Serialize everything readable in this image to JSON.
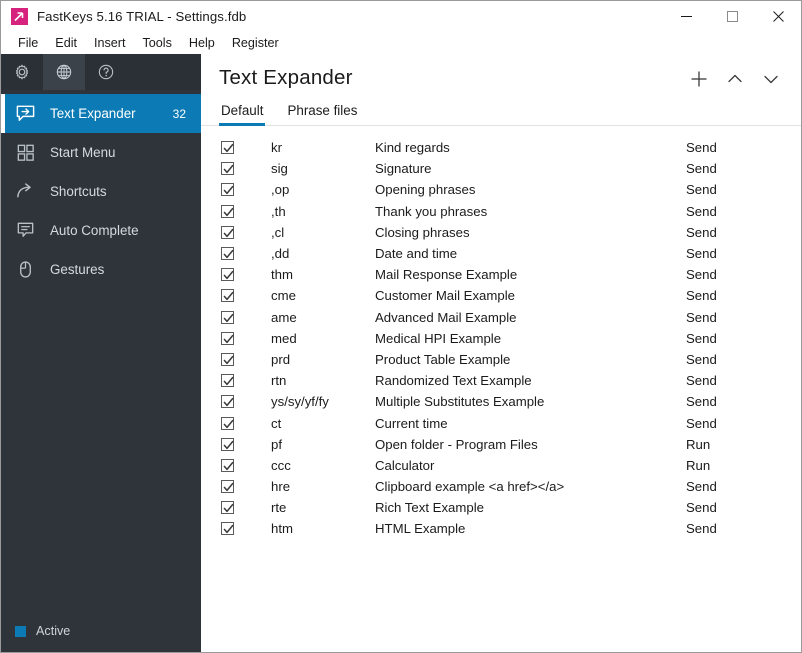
{
  "window": {
    "title": "FastKeys 5.16 TRIAL - Settings.fdb",
    "app_icon": "fastkeys-logo-icon",
    "controls": [
      {
        "name": "minimize-button",
        "icon": "minimize-icon"
      },
      {
        "name": "maximize-button",
        "icon": "maximize-icon"
      },
      {
        "name": "close-button",
        "icon": "close-icon"
      }
    ]
  },
  "menubar": {
    "items": [
      {
        "label": "File"
      },
      {
        "label": "Edit"
      },
      {
        "label": "Insert"
      },
      {
        "label": "Tools"
      },
      {
        "label": "Help"
      },
      {
        "label": "Register"
      }
    ]
  },
  "sidebar": {
    "icon_strip": [
      {
        "name": "settings-gear-icon",
        "icon": "gear-icon",
        "active": false
      },
      {
        "name": "globe-language-icon",
        "icon": "globe-icon",
        "active": true
      },
      {
        "name": "help-icon",
        "icon": "question-circle-icon",
        "active": false
      }
    ],
    "items": [
      {
        "label": "Text Expander",
        "icon": "text-expander-icon",
        "badge": "32",
        "selected": true
      },
      {
        "label": "Start Menu",
        "icon": "grid-squares-icon",
        "badge": "",
        "selected": false
      },
      {
        "label": "Shortcuts",
        "icon": "curved-arrow-icon",
        "badge": "",
        "selected": false
      },
      {
        "label": "Auto Complete",
        "icon": "speech-bubble-lines-icon",
        "badge": "",
        "selected": false
      },
      {
        "label": "Gestures",
        "icon": "mouse-icon",
        "badge": "",
        "selected": false
      }
    ],
    "status": {
      "label": "Active",
      "dot_color": "#0b7ab5"
    }
  },
  "main": {
    "title": "Text Expander",
    "actions": [
      {
        "name": "add-button",
        "icon": "plus-icon"
      },
      {
        "name": "move-up-button",
        "icon": "chevron-up-icon"
      },
      {
        "name": "move-down-button",
        "icon": "chevron-down-icon"
      }
    ],
    "tabs": [
      {
        "label": "Default",
        "active": true
      },
      {
        "label": "Phrase files",
        "active": false
      }
    ],
    "rows": [
      {
        "checked": true,
        "abbr": "kr",
        "desc": "Kind regards",
        "action": "Send"
      },
      {
        "checked": true,
        "abbr": "sig",
        "desc": "Signature",
        "action": "Send"
      },
      {
        "checked": true,
        "abbr": ",op",
        "desc": "Opening phrases",
        "action": "Send"
      },
      {
        "checked": true,
        "abbr": ",th",
        "desc": "Thank you phrases",
        "action": "Send"
      },
      {
        "checked": true,
        "abbr": ",cl",
        "desc": "Closing phrases",
        "action": "Send"
      },
      {
        "checked": true,
        "abbr": ",dd",
        "desc": "Date and time",
        "action": "Send"
      },
      {
        "checked": true,
        "abbr": "thm",
        "desc": "Mail Response Example",
        "action": "Send"
      },
      {
        "checked": true,
        "abbr": "cme",
        "desc": "Customer Mail Example",
        "action": "Send"
      },
      {
        "checked": true,
        "abbr": "ame",
        "desc": "Advanced Mail Example",
        "action": "Send"
      },
      {
        "checked": true,
        "abbr": "med",
        "desc": "Medical HPI Example",
        "action": "Send"
      },
      {
        "checked": true,
        "abbr": "prd",
        "desc": "Product Table Example",
        "action": "Send"
      },
      {
        "checked": true,
        "abbr": "rtn",
        "desc": "Randomized Text Example",
        "action": "Send"
      },
      {
        "checked": true,
        "abbr": "ys/sy/yf/fy",
        "desc": "Multiple Substitutes Example",
        "action": "Send"
      },
      {
        "checked": true,
        "abbr": "ct",
        "desc": "Current time",
        "action": "Send"
      },
      {
        "checked": true,
        "abbr": "pf",
        "desc": "Open folder - Program Files",
        "action": "Run"
      },
      {
        "checked": true,
        "abbr": "ccc",
        "desc": "Calculator",
        "action": "Run"
      },
      {
        "checked": true,
        "abbr": "hre",
        "desc": "Clipboard example <a href></a>",
        "action": "Send"
      },
      {
        "checked": true,
        "abbr": "rte",
        "desc": "Rich Text Example",
        "action": "Send"
      },
      {
        "checked": true,
        "abbr": "htm",
        "desc": "HTML Example",
        "action": "Send"
      }
    ]
  },
  "colors": {
    "accent": "#0b7ab5",
    "sidebar_bg": "#2e3439",
    "icon_strip_bg": "#2b3036",
    "brand_pink": "#d6237e"
  }
}
